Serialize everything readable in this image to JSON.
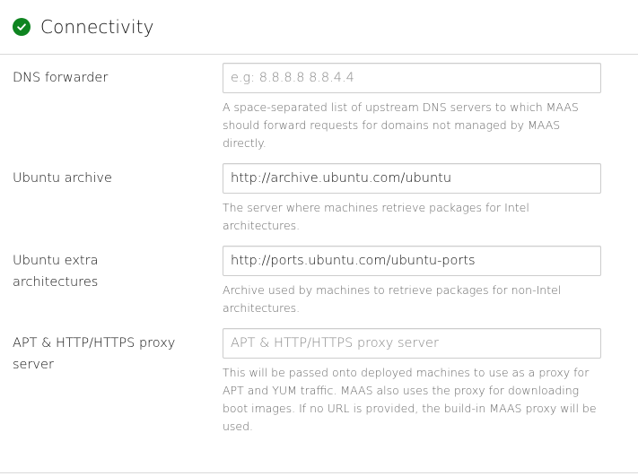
{
  "section": {
    "title": "Connectivity",
    "status_icon": "success-check-icon",
    "status_color": "#0e8420"
  },
  "fields": [
    {
      "label": "DNS forwarder",
      "value": "",
      "placeholder": "e.g: 8.8.8.8 8.8.4.4",
      "help": "A space-separated list of upstream DNS servers to which MAAS should forward requests for domains not managed by MAAS directly."
    },
    {
      "label": "Ubuntu archive",
      "value": "http://archive.ubuntu.com/ubuntu",
      "placeholder": "",
      "help": "The server where machines retrieve packages for Intel architectures."
    },
    {
      "label": "Ubuntu extra architectures",
      "value": "http://ports.ubuntu.com/ubuntu-ports",
      "placeholder": "",
      "help": "Archive used by machines to retrieve packages for non-Intel architectures."
    },
    {
      "label": "APT & HTTP/HTTPS proxy server",
      "value": "",
      "placeholder": "APT & HTTP/HTTPS proxy server",
      "help": "This will be passed onto deployed machines to use as a proxy for APT and YUM traffic. MAAS also uses the proxy for downloading boot images. If no URL is provided, the build-in MAAS proxy will be used."
    }
  ]
}
